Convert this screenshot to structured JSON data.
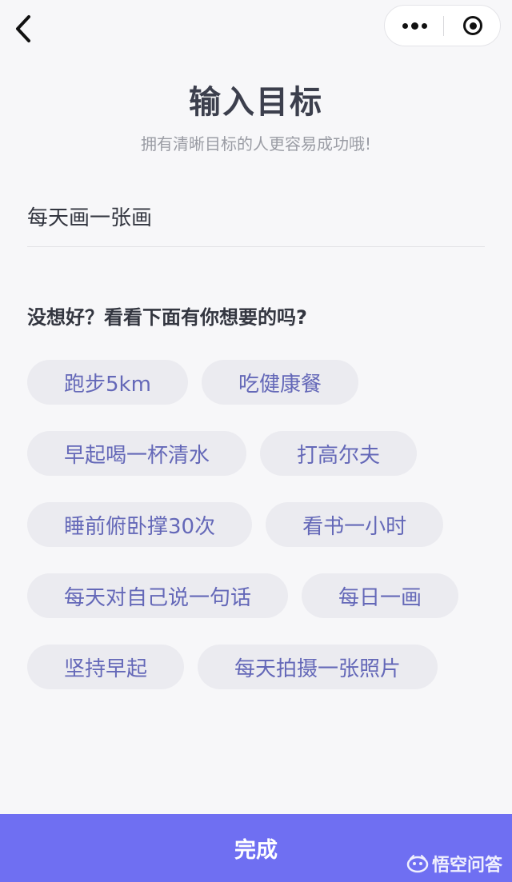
{
  "nav": {
    "back_icon": "chevron-left-icon",
    "more_icon": "more-dots-icon",
    "close_icon": "target-close-icon"
  },
  "header": {
    "title": "输入目标",
    "subtitle": "拥有清晰目标的人更容易成功哦!"
  },
  "goal_input": {
    "value": "每天画一张画"
  },
  "suggestions": {
    "heading": "没想好？看看下面有你想要的吗?",
    "rows": [
      [
        "跑步5km",
        "吃健康餐"
      ],
      [
        "早起喝一杯清水",
        "打高尔夫"
      ],
      [
        "睡前俯卧撑30次",
        "看书一小时"
      ],
      [
        "每天对自己说一句话",
        "每日一画"
      ],
      [
        "坚持早起",
        "每天拍摄一张照片"
      ]
    ]
  },
  "footer": {
    "done_label": "完成",
    "watermark_text": "悟空问答"
  },
  "colors": {
    "accent": "#6f6ff2",
    "chip_text": "#6468b8",
    "chip_bg": "#ebebf0",
    "background": "#f7f7f9"
  }
}
